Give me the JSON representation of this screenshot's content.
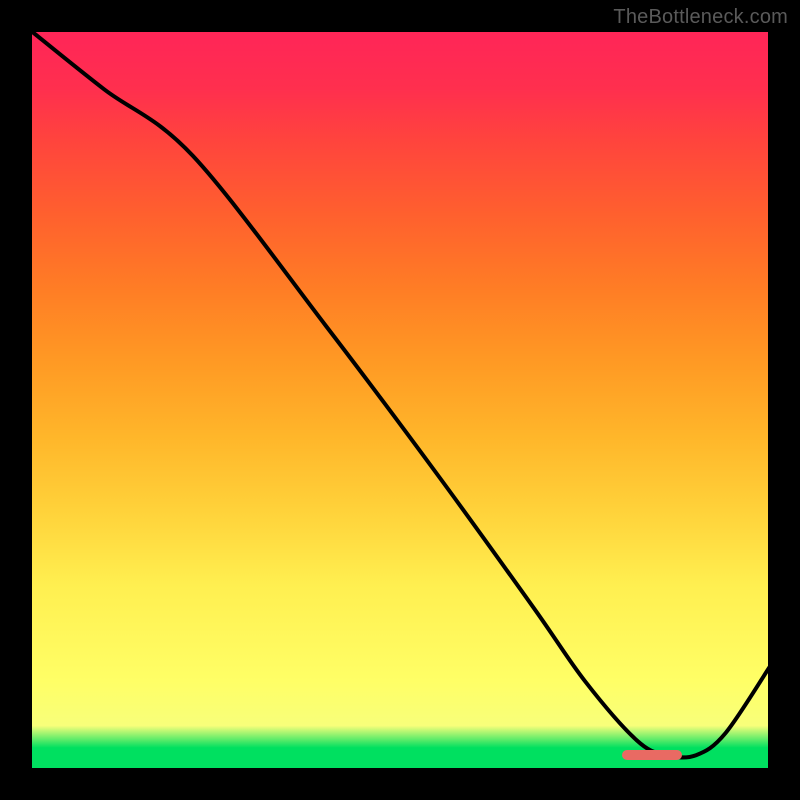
{
  "watermark": "TheBottleneck.com",
  "chart_data": {
    "type": "line",
    "title": "",
    "xlabel": "",
    "ylabel": "",
    "xlim": [
      0,
      100
    ],
    "ylim": [
      0,
      100
    ],
    "grid": false,
    "legend": false,
    "series": [
      {
        "name": "curve",
        "x": [
          0,
          10,
          22,
          40,
          55,
          68,
          75,
          82,
          86,
          90,
          94,
          100
        ],
        "y": [
          100,
          92,
          83,
          60,
          40,
          22,
          12,
          4,
          2,
          2,
          5,
          14
        ]
      }
    ],
    "marker": {
      "x": 84,
      "y": 2,
      "color": "#e96a63"
    },
    "gradient_stops": [
      {
        "pct": 0,
        "color": "#00e060"
      },
      {
        "pct": 3,
        "color": "#00e060"
      },
      {
        "pct": 6,
        "color": "#f8ff7a"
      },
      {
        "pct": 12,
        "color": "#ffff66"
      },
      {
        "pct": 25,
        "color": "#ffef50"
      },
      {
        "pct": 35,
        "color": "#ffd23a"
      },
      {
        "pct": 45,
        "color": "#ffb62a"
      },
      {
        "pct": 55,
        "color": "#ff9a24"
      },
      {
        "pct": 65,
        "color": "#ff7d25"
      },
      {
        "pct": 75,
        "color": "#ff602e"
      },
      {
        "pct": 85,
        "color": "#ff443d"
      },
      {
        "pct": 92,
        "color": "#ff2f4e"
      },
      {
        "pct": 100,
        "color": "#ff2558"
      }
    ]
  }
}
